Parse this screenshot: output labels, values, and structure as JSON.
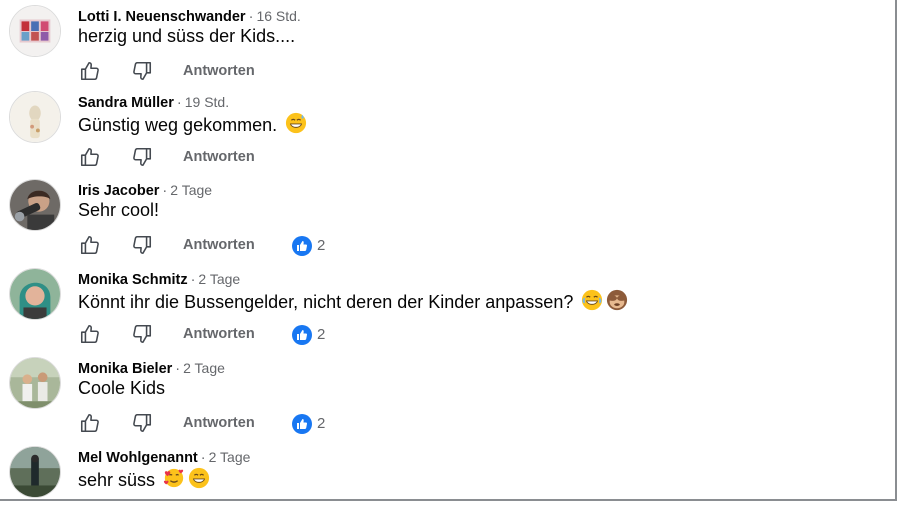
{
  "comments": [
    {
      "author": "Lotti I. Neuenschwander",
      "time": "16 Std.",
      "text": "herzig und süss der Kids....",
      "reply_label": "Antworten",
      "reactions": "",
      "emojis": []
    },
    {
      "author": "Sandra Müller",
      "time": "19 Std.",
      "text": "Günstig weg gekommen.",
      "reply_label": "Antworten",
      "reactions": "",
      "emojis": [
        "grinning-sweat-emoji"
      ]
    },
    {
      "author": "Iris Jacober",
      "time": "2 Tage",
      "text": "Sehr cool!",
      "reply_label": "Antworten",
      "reactions": "2",
      "emojis": []
    },
    {
      "author": "Monika Schmitz",
      "time": "2 Tage",
      "text": "Könnt ihr die Bussengelder, nicht deren der Kinder anpassen?",
      "reply_label": "Antworten",
      "reactions": "2",
      "emojis": [
        "joy-emoji",
        "see-no-evil-monkey-emoji"
      ]
    },
    {
      "author": "Monika Bieler",
      "time": "2 Tage",
      "text": "Coole Kids",
      "reply_label": "Antworten",
      "reactions": "2",
      "emojis": []
    },
    {
      "author": "Mel Wohlgenannt",
      "time": "2 Tage",
      "text": "sehr süss",
      "reply_label": "",
      "reactions": "",
      "emojis": [
        "smiling-hearts-emoji",
        "grinning-emoji"
      ]
    }
  ],
  "separator": "·",
  "icons": {
    "like": "thumbs-up-outline-icon",
    "dislike": "thumbs-down-outline-icon",
    "reaction": "blue-like-reaction-icon"
  },
  "colors": {
    "secondary_text": "#65676b",
    "primary_text": "#050505",
    "reaction_blue": "#1877f2"
  }
}
